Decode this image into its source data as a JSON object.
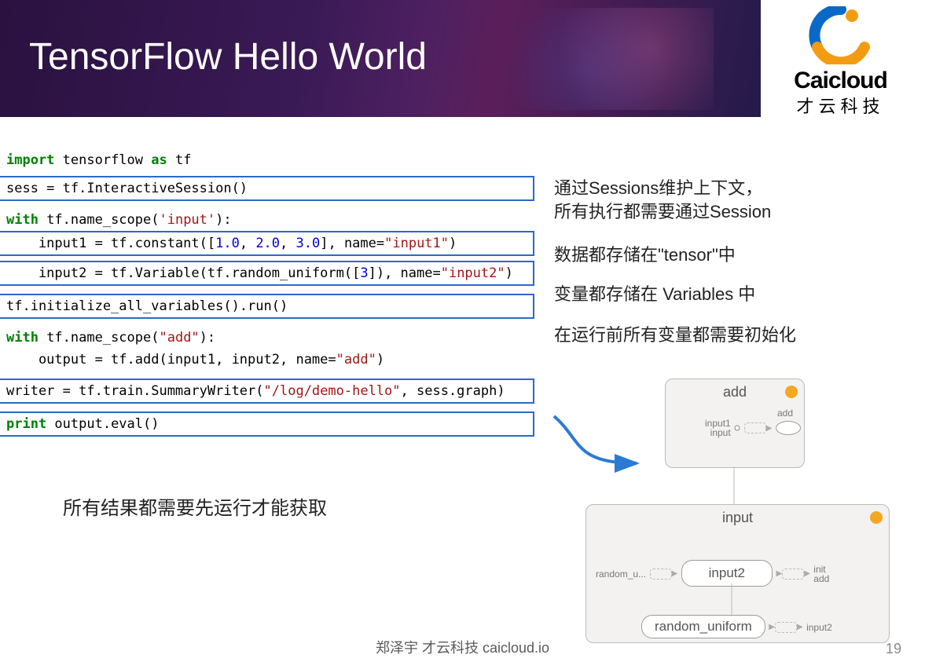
{
  "header": {
    "title": "TensorFlow Hello World"
  },
  "brand": {
    "name": "Caicloud",
    "cn": "才云科技"
  },
  "code": {
    "l1": "import tensorflow as tf",
    "l2": "sess = tf.InteractiveSession()",
    "l3": "with tf.name_scope('input'):",
    "l4": "    input1 = tf.constant([1.0, 2.0, 3.0], name=\"input1\")",
    "l5": "    input2 = tf.Variable(tf.random_uniform([3]), name=\"input2\")",
    "l6": "tf.initialize_all_variables().run()",
    "l7": "with tf.name_scope(\"add\"):",
    "l8": "    output = tf.add(input1, input2, name=\"add\")",
    "l9": "writer = tf.train.SummaryWriter(\"/log/demo-hello\", sess.graph)",
    "l10": "print output.eval()"
  },
  "annotations": {
    "a1_l1": "通过Sessions维护上下文，",
    "a1_l2": "所有执行都需要通过Session",
    "a2": "数据都存储在\"tensor\"中",
    "a3": "变量都存储在 Variables 中",
    "a4": "在运行前所有变量都需要初始化",
    "a5": "所有结果都需要先运行才能获取"
  },
  "graph": {
    "add_box_title": "add",
    "add_node": "add",
    "input1_label": "input1",
    "input_label_small": "input",
    "input_box_title": "input",
    "input2_node": "input2",
    "random_node": "random_uniform",
    "random_short": "random_u...",
    "init_label": "init",
    "add_label": "add",
    "input2_label": "input2"
  },
  "footer": {
    "author": "郑泽宇 才云科技 caicloud.io",
    "page": "19"
  }
}
